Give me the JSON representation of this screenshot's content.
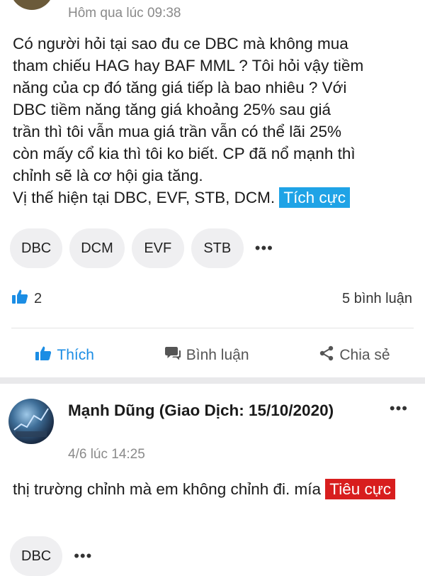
{
  "post1": {
    "timestamp": "Hôm qua lúc 09:38",
    "body_lines": [
      "Có người hỏi tại sao đu ce DBC mà không mua",
      "tham chiếu HAG hay BAF MML ? Tôi hỏi vậy tiềm",
      "năng của cp đó tăng giá tiếp là bao nhiêu ? Với",
      "DBC tiềm năng tăng giá khoảng 25% sau giá",
      "trần thì tôi vẫn mua giá trần vẫn có thể lãi 25%",
      "còn mấy cổ kia thì tôi ko biết. CP đã nổ mạnh thì",
      "chỉnh sẽ là cơ hội gia tăng."
    ],
    "position_line": "Vị thế hiện tại DBC, EVF, STB, DCM.",
    "sentiment": "Tích cực",
    "tags": [
      "DBC",
      "DCM",
      "EVF",
      "STB"
    ],
    "more": "•••",
    "like_count": "2",
    "comment_count": "5 bình luận",
    "actions": {
      "like": "Thích",
      "comment": "Bình luận",
      "share": "Chia sẻ"
    },
    "colors": {
      "like_blue": "#1b8de4",
      "positive": "#1fa3e6"
    }
  },
  "post2": {
    "author": "Mạnh Dũng (Giao Dịch: 15/10/2020)",
    "menu": "•••",
    "timestamp": "4/6 lúc 14:25",
    "body": "thị trường chỉnh mà em không chỉnh đi. mía",
    "sentiment": "Tiêu cực",
    "tags": [
      "DBC"
    ],
    "more": "•••",
    "colors": {
      "negative": "#d81e1e"
    }
  }
}
